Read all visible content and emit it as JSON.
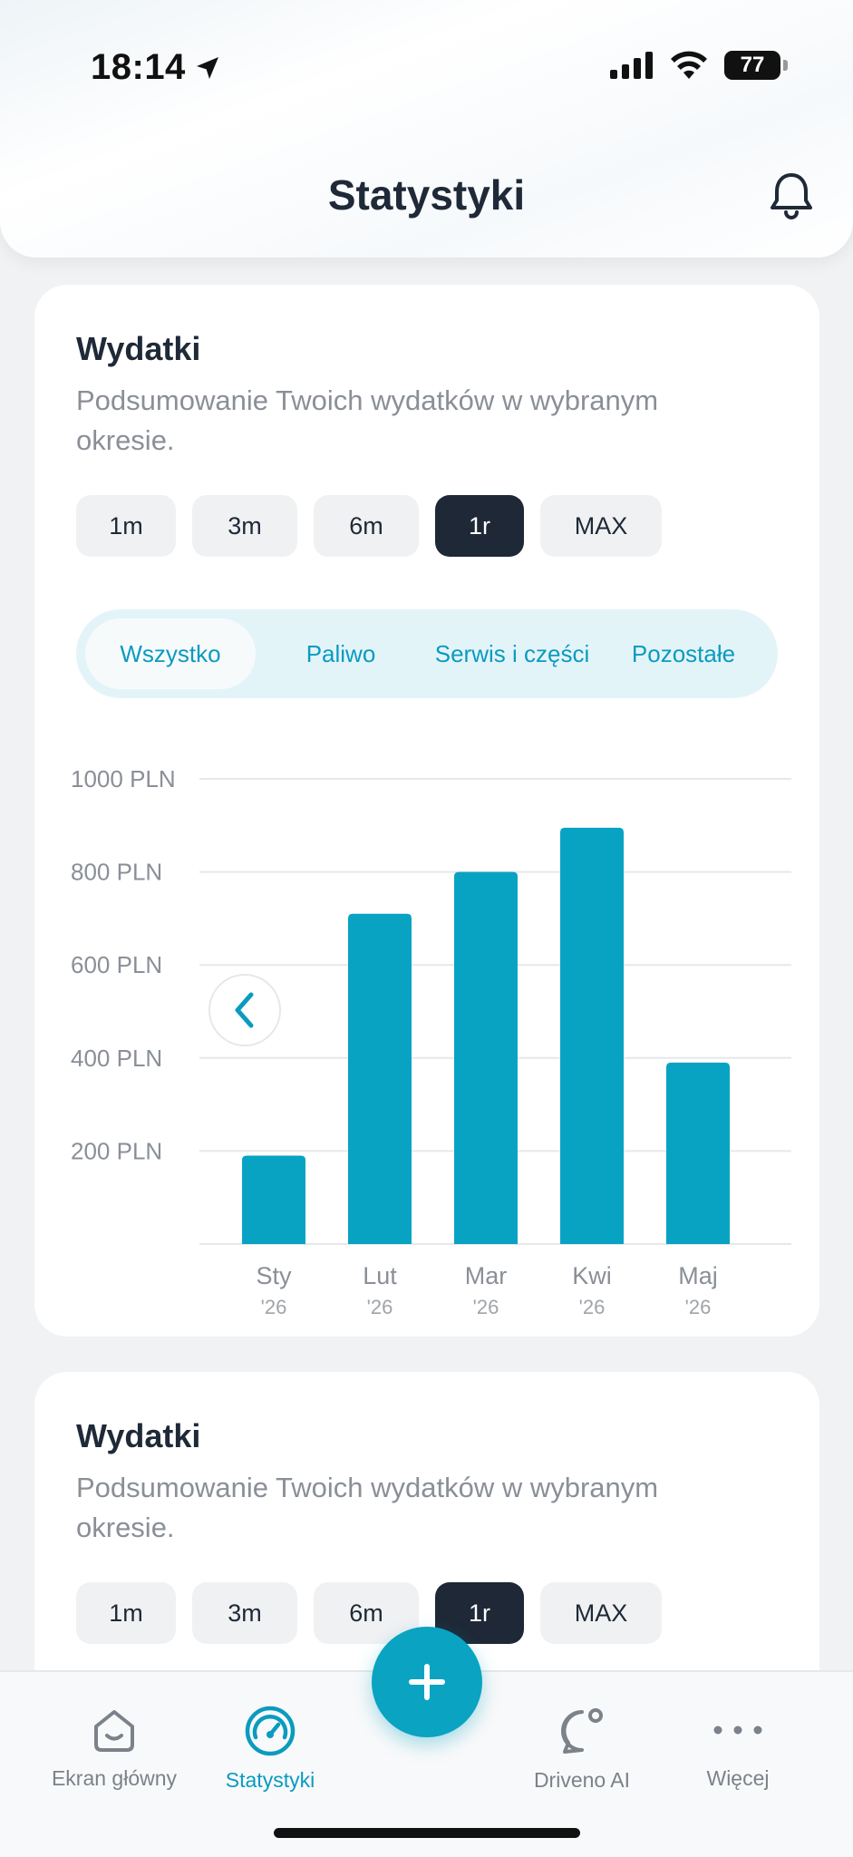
{
  "status_bar": {
    "time": "18:14",
    "battery": "77"
  },
  "header": {
    "title": "Statystyki"
  },
  "colors": {
    "accent": "#0aa3c2",
    "dark_button": "#1e2836",
    "bar": "#08a3c3"
  },
  "cards": [
    {
      "title": "Wydatki",
      "subtitle": "Podsumowanie Twoich wydatków w wybranym okresie.",
      "periods": [
        "1m",
        "3m",
        "6m",
        "1r",
        "MAX"
      ],
      "active_period": "1r",
      "filters": [
        "Wszystko",
        "Paliwo",
        "Serwis i części",
        "Pozostałe"
      ],
      "active_filter": "Wszystko"
    },
    {
      "title": "Wydatki",
      "subtitle": "Podsumowanie Twoich wydatków w wybranym okresie.",
      "periods": [
        "1m",
        "3m",
        "6m",
        "1r",
        "MAX"
      ],
      "active_period": "1r"
    }
  ],
  "chart_data": {
    "type": "bar",
    "categories": [
      "Sty",
      "Lut",
      "Mar",
      "Kwi",
      "Maj"
    ],
    "category_years": [
      "'26",
      "'26",
      "'26",
      "'26",
      "'26"
    ],
    "values": [
      190,
      710,
      800,
      895,
      390
    ],
    "y_ticks": [
      "1000 PLN",
      "800 PLN",
      "600 PLN",
      "400 PLN",
      "200 PLN"
    ],
    "ylim": [
      0,
      1000
    ],
    "grid": true
  },
  "bottom_nav": {
    "items": [
      {
        "label": "Ekran główny",
        "icon": "home-icon"
      },
      {
        "label": "Statystyki",
        "icon": "speedometer-icon"
      },
      {
        "label": "Driveno AI",
        "icon": "chat-ai-icon"
      },
      {
        "label": "Więcej",
        "icon": "more-dots-icon"
      }
    ],
    "active": "Statystyki",
    "fab_icon": "plus-icon"
  }
}
